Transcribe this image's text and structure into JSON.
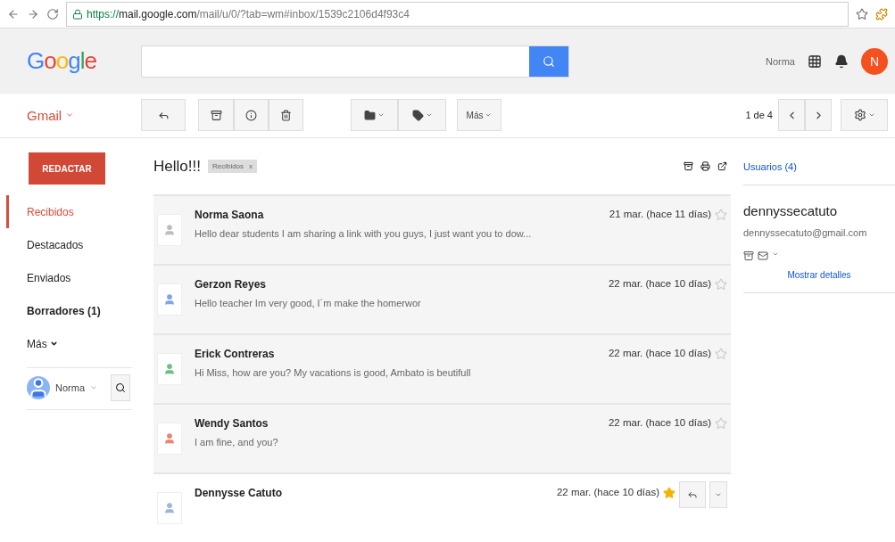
{
  "browser": {
    "url_scheme": "https://",
    "url_host": "mail.google.com",
    "url_path": "/mail/u/0/?tab=wm#inbox/1539c2106d4f93c4"
  },
  "header": {
    "logo": "Google",
    "user_name": "Norma",
    "avatar_letter": "N"
  },
  "app_label": "Gmail",
  "toolbar": {
    "more_button": "Más",
    "pager": "1 de 4"
  },
  "compose_button": "REDACTAR",
  "nav_items": [
    {
      "label": "Recibidos",
      "selected": true,
      "bold": false,
      "kind": "link"
    },
    {
      "label": "Destacados",
      "selected": false,
      "bold": false,
      "kind": "link"
    },
    {
      "label": "Enviados",
      "selected": false,
      "bold": false,
      "kind": "link"
    },
    {
      "label": "Borradores (1)",
      "selected": false,
      "bold": true,
      "kind": "link"
    },
    {
      "label": "Más",
      "selected": false,
      "bold": false,
      "kind": "menu"
    }
  ],
  "chat": {
    "user_name": "Norma"
  },
  "thread": {
    "subject": "Hello!!!",
    "label_chip": "Recibidos",
    "chip_close": "x"
  },
  "messages": [
    {
      "sender": "Norma Saona",
      "snippet": "Hello dear students I am sharing a link with you guys, I just want you to dow...",
      "date": "21 mar. (hace 11 días)",
      "starred": false,
      "color": "#bdbdbd",
      "expanded": false
    },
    {
      "sender": "Gerzon Reyes",
      "snippet": "Hello teacher Im very good, I´m make the homerwor",
      "date": "22 mar. (hace 10 días)",
      "starred": false,
      "color": "#7ea6e0",
      "expanded": false
    },
    {
      "sender": "Erick Contreras",
      "snippet": "Hi Miss, how are you? My vacations is good, Ambato is beutifull",
      "date": "22 mar. (hace 10 días)",
      "starred": false,
      "color": "#6cbf84",
      "expanded": false
    },
    {
      "sender": "Wendy Santos",
      "snippet": "I am fine, and you?",
      "date": "22 mar. (hace 10 días)",
      "starred": false,
      "color": "#e8846f",
      "expanded": false
    },
    {
      "sender": "Dennysse Catuto",
      "date": "22 mar. (hace 10 días)",
      "starred": true,
      "color": "#9fb4d9",
      "expanded": true
    }
  ],
  "people_panel": {
    "heading": "Usuarios (4)",
    "name": "dennyssecatuto",
    "email": "dennyssecatuto@gmail.com",
    "details_link": "Mostrar detalles"
  }
}
